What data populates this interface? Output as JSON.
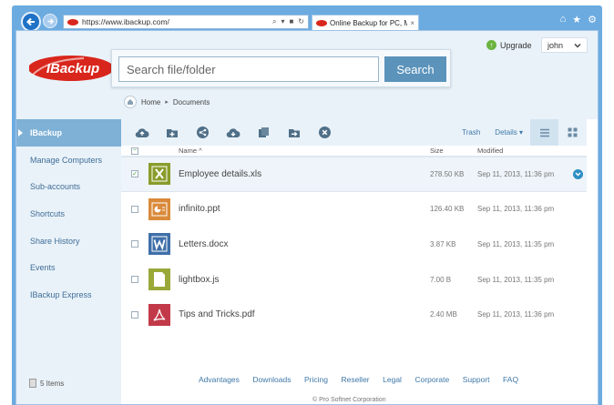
{
  "browser": {
    "url": "https://www.ibackup.com/",
    "tab_title": "Online Backup for PC, Mac ...",
    "tab_close": "×"
  },
  "header": {
    "brand": "IBackup",
    "search_placeholder": "Search file/folder",
    "search_button": "Search",
    "upgrade_label": "Upgrade",
    "user_name": "john"
  },
  "breadcrumb": [
    "Home",
    "Documents"
  ],
  "sidebar": {
    "items": [
      {
        "label": "IBackup",
        "active": true
      },
      {
        "label": "Manage Computers"
      },
      {
        "label": "Sub-accounts"
      },
      {
        "label": "Shortcuts"
      },
      {
        "label": "Share History"
      },
      {
        "label": "Events"
      },
      {
        "label": "IBackup Express"
      }
    ],
    "item_count": "5 Items"
  },
  "toolbar": {
    "icons": [
      "cloud-upload-icon",
      "new-folder-icon",
      "share-icon",
      "cloud-download-icon",
      "copy-icon",
      "move-icon",
      "delete-icon"
    ],
    "trash_label": "Trash",
    "details_label": "Details ▾"
  },
  "list": {
    "headers": {
      "name": "Name ^",
      "size": "Size",
      "modified": "Modified"
    },
    "files": [
      {
        "name": "Employee details.xls",
        "size": "278.50 KB",
        "modified": "Sep 11, 2013, 11:36 pm",
        "type": "xls",
        "selected": true
      },
      {
        "name": "infinito.ppt",
        "size": "126.40 KB",
        "modified": "Sep 11, 2013, 11:36 pm",
        "type": "ppt"
      },
      {
        "name": "Letters.docx",
        "size": "3.87 KB",
        "modified": "Sep 11, 2013, 11:35 pm",
        "type": "docx"
      },
      {
        "name": "lightbox.js",
        "size": "7.00 B",
        "modified": "Sep 11, 2013, 11:35 pm",
        "type": "js"
      },
      {
        "name": "Tips and Tricks.pdf",
        "size": "2.40 MB",
        "modified": "Sep 11, 2013, 11:36 pm",
        "type": "pdf"
      }
    ]
  },
  "footer": {
    "links": [
      "Advantages",
      "Downloads",
      "Pricing",
      "Reseller",
      "Legal",
      "Corporate",
      "Support",
      "FAQ"
    ],
    "copyright": "© Pro Softnet Corporation"
  },
  "colors": {
    "window_frame": "#6cabe0",
    "page_band": "#e9f2f9",
    "sidebar_active": "#7fb1d6",
    "search_button": "#5b93bb",
    "link": "#3f78a8",
    "xls": "#8a9c2b",
    "ppt": "#d98a3a",
    "docx": "#3f6fa8",
    "js": "#9aa83a",
    "pdf": "#c23a4a"
  }
}
